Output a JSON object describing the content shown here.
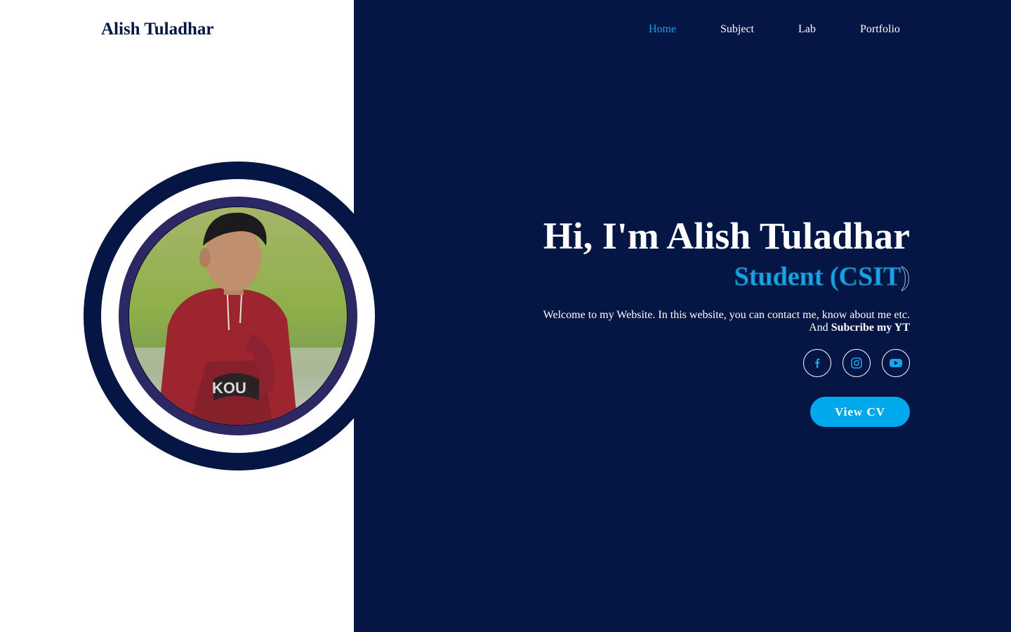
{
  "header": {
    "logo": "Alish Tuladhar",
    "nav": [
      {
        "label": "Home",
        "active": true
      },
      {
        "label": "Subject",
        "active": false
      },
      {
        "label": "Lab",
        "active": false
      },
      {
        "label": "Portfolio",
        "active": false
      }
    ]
  },
  "hero": {
    "greeting": "Hi, I'm Alish Tuladhar",
    "role_typed": "Student (CSIT",
    "role_rest": ")",
    "description": "Welcome to my Website. In this website, you can contact me, know about me etc.",
    "description_prefix": "And",
    "description_bold": "Subcribe my YT",
    "socials": [
      {
        "icon": "facebook-icon"
      },
      {
        "icon": "instagram-icon"
      },
      {
        "icon": "youtube-icon"
      }
    ],
    "cv_button": "View CV"
  },
  "colors": {
    "navy": "#051644",
    "accent": "#1aa3e8",
    "button": "#00a8ec",
    "ring_inner": "#2b2864"
  }
}
